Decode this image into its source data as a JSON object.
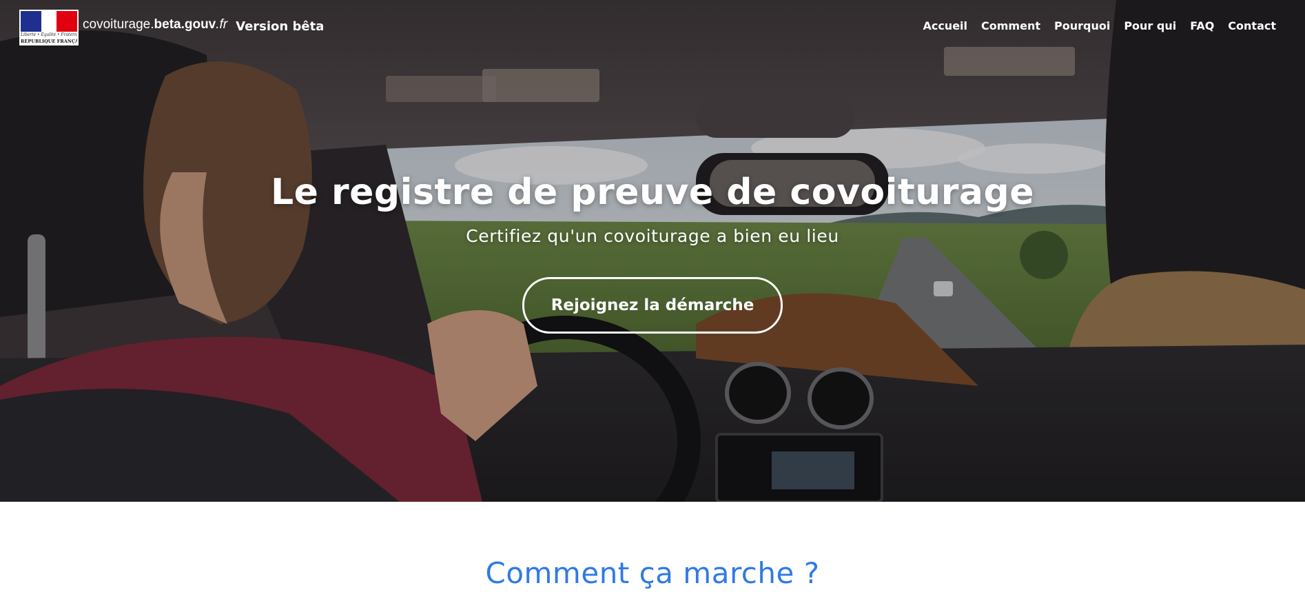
{
  "header": {
    "logo": {
      "motto": "Liberté • Égalité • Fraternité",
      "republic": "RÉPUBLIQUE FRANÇAISE"
    },
    "domain": {
      "part1": "covoiturage.",
      "part2": "beta.gouv",
      "part3": ".fr"
    },
    "version_label": "Version bêta",
    "nav": [
      {
        "label": "Accueil"
      },
      {
        "label": "Comment"
      },
      {
        "label": "Pourquoi"
      },
      {
        "label": "Pour qui"
      },
      {
        "label": "FAQ"
      },
      {
        "label": "Contact"
      }
    ]
  },
  "hero": {
    "title": "Le registre de preuve de covoiturage",
    "subtitle": "Certifiez qu'un covoiturage a bien eu lieu",
    "cta_label": "Rejoignez la démarche"
  },
  "section": {
    "title": "Comment ça marche ?"
  },
  "colors": {
    "accent_blue": "#2f7ae5",
    "flag_blue": "#1f2f8f",
    "flag_red": "#e1000f",
    "hero_text": "#ffffff"
  },
  "icons": {
    "logo": "marianne-logo"
  }
}
